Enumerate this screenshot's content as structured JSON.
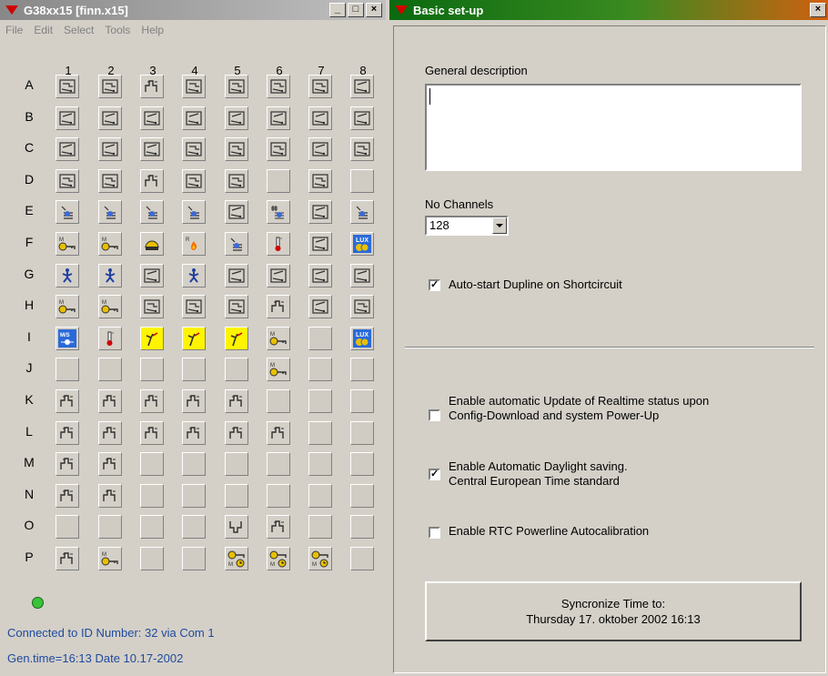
{
  "left_window": {
    "title": "G38xx15 [finn.x15]",
    "menu": [
      "File",
      "Edit",
      "Select",
      "Tools",
      "Help"
    ],
    "columns": [
      "1",
      "2",
      "3",
      "4",
      "5",
      "6",
      "7",
      "8"
    ],
    "rows": [
      {
        "label": "A",
        "cells": [
          "dimmer",
          "dimmer",
          "pulse",
          "dimmer",
          "dimmer",
          "dimmer",
          "dimmer",
          "switch"
        ]
      },
      {
        "label": "B",
        "cells": [
          "switch",
          "switch",
          "switch",
          "switch",
          "switch",
          "switch",
          "switch",
          "switch"
        ]
      },
      {
        "label": "C",
        "cells": [
          "switch",
          "switch",
          "switch",
          "dimmer",
          "dimmer",
          "dimmer",
          "switch",
          "dimmer"
        ]
      },
      {
        "label": "D",
        "cells": [
          "dimmer",
          "dimmer",
          "pulse",
          "dimmer",
          "dimmer",
          "empty",
          "dimmer",
          "empty"
        ]
      },
      {
        "label": "E",
        "cells": [
          "blind",
          "blind",
          "blind",
          "blind",
          "switch",
          "blind-hash",
          "switch",
          "blind"
        ]
      },
      {
        "label": "F",
        "cells": [
          "key",
          "key",
          "motion",
          "fire",
          "blind",
          "thermo",
          "switch",
          "lux"
        ]
      },
      {
        "label": "G",
        "cells": [
          "person",
          "person",
          "switch",
          "person",
          "switch",
          "switch",
          "switch",
          "switch"
        ]
      },
      {
        "label": "H",
        "cells": [
          "key",
          "key",
          "dimmer",
          "dimmer",
          "dimmer",
          "pulse",
          "switch",
          "dimmer"
        ]
      },
      {
        "label": "I",
        "cells": [
          "ms",
          "thermo",
          "y-sensor",
          "y-sensor",
          "y-sensor",
          "key",
          "empty",
          "lux"
        ]
      },
      {
        "label": "J",
        "cells": [
          "empty",
          "empty",
          "empty",
          "empty",
          "empty",
          "key",
          "empty",
          "empty"
        ]
      },
      {
        "label": "K",
        "cells": [
          "pulse",
          "pulse",
          "pulse",
          "pulse",
          "pulse",
          "empty",
          "empty",
          "empty"
        ]
      },
      {
        "label": "L",
        "cells": [
          "pulse",
          "pulse",
          "pulse",
          "pulse",
          "pulse",
          "pulse",
          "empty",
          "empty"
        ]
      },
      {
        "label": "M",
        "cells": [
          "pulse",
          "pulse",
          "empty",
          "empty",
          "empty",
          "empty",
          "empty",
          "empty"
        ]
      },
      {
        "label": "N",
        "cells": [
          "pulse",
          "pulse",
          "empty",
          "empty",
          "empty",
          "empty",
          "empty",
          "empty"
        ]
      },
      {
        "label": "O",
        "cells": [
          "empty",
          "empty",
          "empty",
          "empty",
          "pulse-alt",
          "pulse",
          "empty",
          "empty"
        ]
      },
      {
        "label": "P",
        "cells": [
          "pulse",
          "key",
          "empty",
          "empty",
          "clock",
          "clock",
          "clock",
          "empty"
        ]
      }
    ],
    "status_line1": "Connected to ID Number:  32  via Com  1",
    "status_line2": "Gen.time=16:13  Date  10.17-2002",
    "led_color": "#3ac23a"
  },
  "right_window": {
    "title": "Basic set-up",
    "general_description_label": "General description",
    "general_description_value": "",
    "no_channels_label": "No Channels",
    "no_channels_value": "128",
    "autostart_label": "Auto-start Dupline on Shortcircuit",
    "autostart_checked": true,
    "enable_update_label_1": "Enable automatic Update of Realtime status upon",
    "enable_update_label_2": "Config-Download and system Power-Up",
    "enable_update_checked": false,
    "daylight_label_1": "Enable Automatic Daylight saving.",
    "daylight_label_2": "Central European Time standard",
    "daylight_checked": true,
    "rtc_label": "Enable RTC Powerline Autocalibration",
    "rtc_checked": false,
    "sync_line1": "Syncronize Time to:",
    "sync_line2": "Thursday  17. oktober 2002  16:13"
  }
}
